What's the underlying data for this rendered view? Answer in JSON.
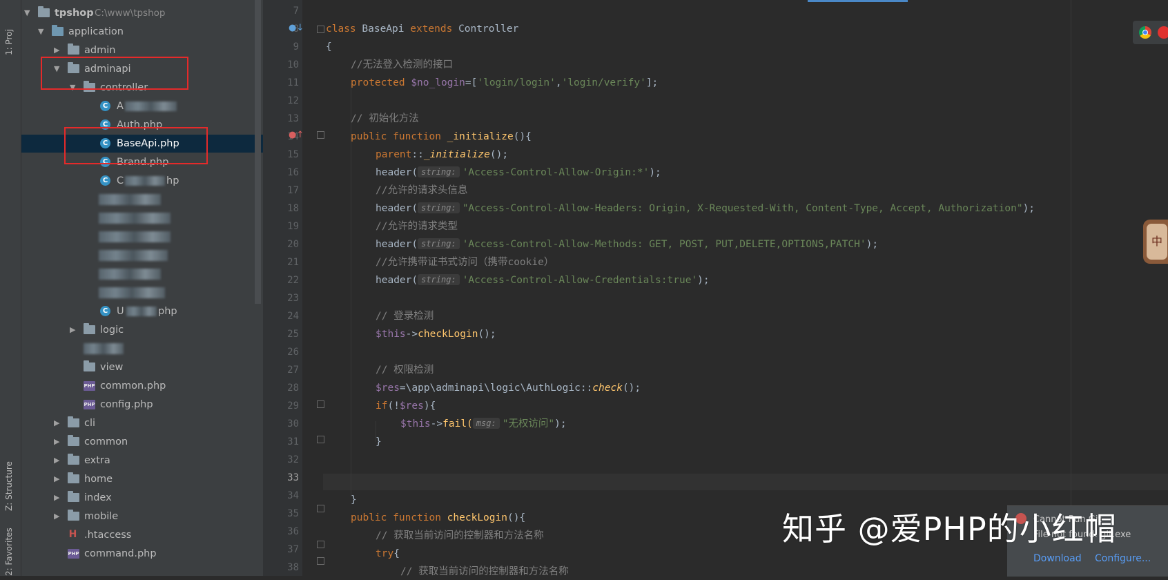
{
  "sidebar_tabs": {
    "project": "1: Proj",
    "structure": "Z: Structure",
    "favorites": "2: Favorites"
  },
  "tree": {
    "root_name": "tpshop",
    "root_path": "C:\\www\\tpshop",
    "application": "application",
    "admin": "admin",
    "adminapi": "adminapi",
    "controller": "controller",
    "files": {
      "f1": "A",
      "auth": "Auth.php",
      "baseapi": "BaseApi.php",
      "brand": "Brand.php",
      "f5a": "C",
      "f5b": "hp",
      "f10": "U",
      "f10b": "php"
    },
    "logic": "logic",
    "view": "view",
    "common_php": "common.php",
    "config_php": "config.php",
    "cli": "cli",
    "common": "common",
    "extra": "extra",
    "home": "home",
    "index": "index",
    "mobile": "mobile",
    "htaccess": ".htaccess",
    "command_php": "command.php"
  },
  "line_numbers": [
    "7",
    "8",
    "9",
    "10",
    "11",
    "12",
    "13",
    "14",
    "15",
    "16",
    "17",
    "18",
    "19",
    "20",
    "21",
    "22",
    "23",
    "24",
    "25",
    "26",
    "27",
    "28",
    "29",
    "30",
    "31",
    "32",
    "33",
    "34",
    "35",
    "36",
    "37",
    "38"
  ],
  "code": {
    "l8": {
      "kw": "class",
      "name": " BaseApi ",
      "ext": "extends",
      "parent": " Controller"
    },
    "l9": "{",
    "l10": "//无法登入检测的接口",
    "l11": {
      "kw": "protected",
      "var": "$no_login",
      "p1": "=[",
      "s1": "'login/login'",
      "comma": ",",
      "s2": "'login/verify'",
      "end": "];"
    },
    "l13": "// 初始化方法",
    "l14": {
      "kw": "public function",
      "fn": " _initialize",
      "end": "(){"
    },
    "l15": {
      "kw": "parent",
      "p": "::",
      "it": "_initialize",
      "end": "();"
    },
    "l16": {
      "fn": "header(",
      "hint": "string:",
      "str": "'Access-Control-Allow-Origin:*'",
      "end": ");"
    },
    "l17": "//允许的请求头信息",
    "l18": {
      "fn": "header(",
      "hint": "string:",
      "str": "\"Access-Control-Allow-Headers: Origin, X-Requested-With, Content-Type, Accept, Authorization\"",
      "end": ");"
    },
    "l19": "//允许的请求类型",
    "l20": {
      "fn": "header(",
      "hint": "string:",
      "str": "'Access-Control-Allow-Methods: GET, POST, PUT,DELETE,OPTIONS,PATCH'",
      "end": ");"
    },
    "l21": "//允许携带证书式访问（携带cookie）",
    "l22": {
      "fn": "header(",
      "hint": "string:",
      "str": "'Access-Control-Allow-Credentials:true'",
      "end": ");"
    },
    "l24": "// 登录检测",
    "l25": {
      "var": "$this",
      "arrow": "->",
      "fn": "checkLogin",
      "end": "();"
    },
    "l27": "// 权限检测",
    "l28": {
      "var": "$res",
      "p": "=\\app\\adminapi\\logic\\",
      "cls": "AuthLogic",
      "sep": "::",
      "it": "check",
      "end": "();"
    },
    "l29": {
      "kw": "if",
      "p": "(!",
      "var": "$res",
      "end": "){"
    },
    "l30": {
      "var": "$this",
      "arrow": "->",
      "fn": "fail(",
      "hint": "msg:",
      "str": "\"无权访问\"",
      "end": ");"
    },
    "l31": "}",
    "l34": "}",
    "l35": {
      "kw": "public function",
      "fn": " checkLogin",
      "end": "(){"
    },
    "l36": "// 获取当前访问的控制器和方法名称",
    "l37": {
      "kw": "try",
      "end": "{"
    },
    "l38": "// 获取当前访问的控制器和方法名称"
  },
  "notification": {
    "line1": "Cannot Run Git",
    "line2": "File not found: git.exe",
    "download": "Download",
    "configure": "Configure..."
  },
  "watermark": "知乎 @爱PHP的小红帽",
  "colors": {
    "keyword": "#cc7832",
    "string": "#6a8759",
    "comment": "#808080",
    "function": "#ffc66d",
    "variable": "#9876aa",
    "selection": "#0d293e",
    "annotation_box": "#e52a2a"
  }
}
